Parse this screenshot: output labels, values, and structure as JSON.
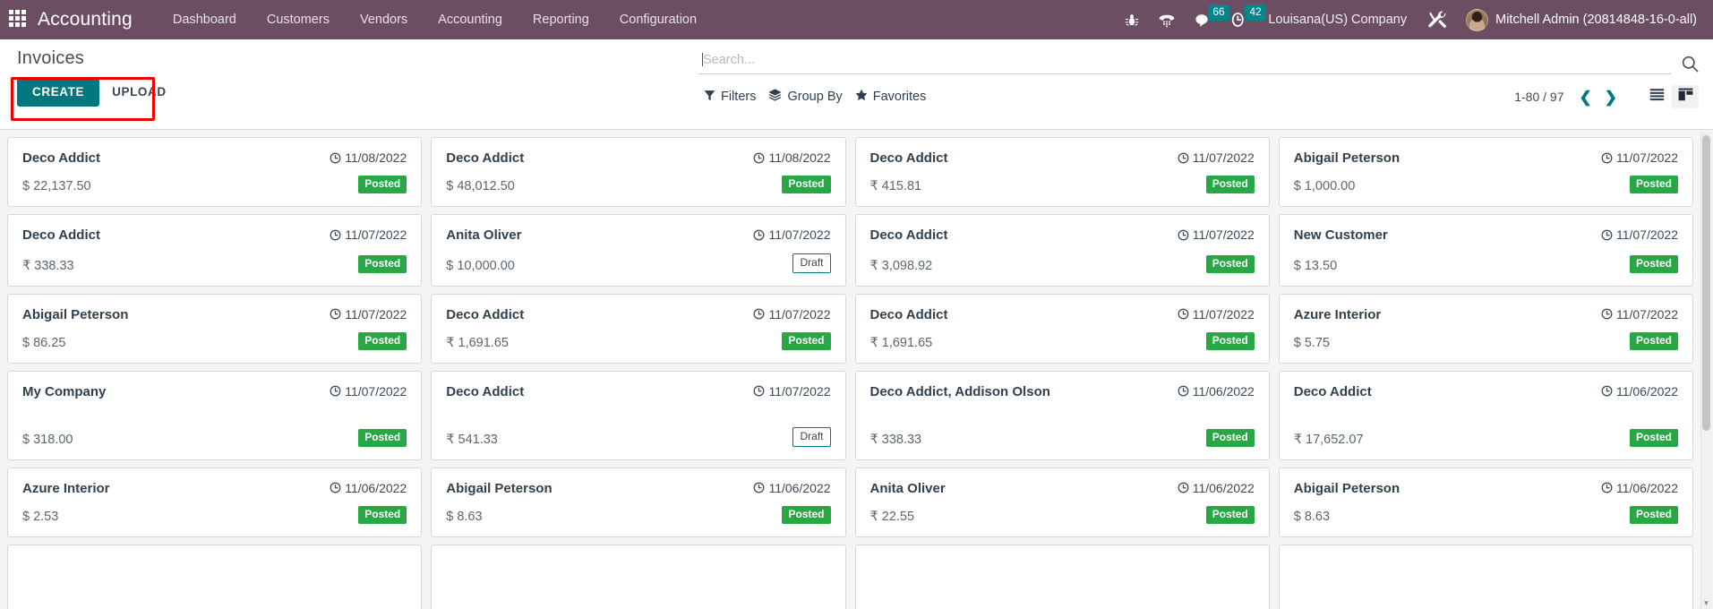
{
  "navbar": {
    "apps_icon": "apps-grid-icon",
    "brand": "Accounting",
    "menu": [
      {
        "label": "Dashboard"
      },
      {
        "label": "Customers"
      },
      {
        "label": "Vendors"
      },
      {
        "label": "Accounting"
      },
      {
        "label": "Reporting"
      },
      {
        "label": "Configuration"
      }
    ],
    "icons": {
      "bug": "bug-icon",
      "phone": "dialpad-phone-icon",
      "messages": "chat-bubble-icon",
      "activities": "clock-activity-icon",
      "tools": "wrench-screwdriver-icon"
    },
    "messages_count": "66",
    "activities_count": "42",
    "company": "Louisana(US) Company",
    "user": "Mitchell Admin (20814848-16-0-all)"
  },
  "control_panel": {
    "title": "Invoices",
    "create_label": "CREATE",
    "upload_label": "UPLOAD",
    "search": {
      "value": "",
      "placeholder": "Search...",
      "icon": "search-icon"
    },
    "tools": [
      {
        "label": "Filters",
        "icon": "filter-funnel-icon"
      },
      {
        "label": "Group By",
        "icon": "layers-icon"
      },
      {
        "label": "Favorites",
        "icon": "star-icon"
      }
    ],
    "pager": {
      "range": "1-80 / 97",
      "prev_icon": "chevron-left-icon",
      "next_icon": "chevron-right-icon"
    },
    "views": [
      {
        "name": "list-view",
        "icon": "list-icon",
        "active": false
      },
      {
        "name": "kanban-view",
        "icon": "kanban-icon",
        "active": true
      }
    ],
    "highlight_color": "#f00000"
  },
  "colors": {
    "navbar_bg": "#6b4e61",
    "primary": "#00787d",
    "posted_badge": "#28a745",
    "badge_count": "#00868b"
  },
  "kanban": {
    "date_icon": "clock-icon",
    "cards": [
      {
        "name": "Deco Addict",
        "date": "11/08/2022",
        "amount": "$ 22,137.50",
        "status": "Posted",
        "state": "posted",
        "tall": false
      },
      {
        "name": "Deco Addict",
        "date": "11/08/2022",
        "amount": "$ 48,012.50",
        "status": "Posted",
        "state": "posted",
        "tall": false
      },
      {
        "name": "Deco Addict",
        "date": "11/07/2022",
        "amount": "₹ 415.81",
        "status": "Posted",
        "state": "posted",
        "tall": false
      },
      {
        "name": "Abigail Peterson",
        "date": "11/07/2022",
        "amount": "$ 1,000.00",
        "status": "Posted",
        "state": "posted",
        "tall": false
      },
      {
        "name": "Deco Addict",
        "date": "11/07/2022",
        "amount": "₹ 338.33",
        "status": "Posted",
        "state": "posted",
        "tall": false
      },
      {
        "name": "Anita Oliver",
        "date": "11/07/2022",
        "amount": "$ 10,000.00",
        "status": "Draft",
        "state": "draft",
        "tall": false
      },
      {
        "name": "Deco Addict",
        "date": "11/07/2022",
        "amount": "₹ 3,098.92",
        "status": "Posted",
        "state": "posted",
        "tall": false
      },
      {
        "name": "New Customer",
        "date": "11/07/2022",
        "amount": "$ 13.50",
        "status": "Posted",
        "state": "posted",
        "tall": false
      },
      {
        "name": "Abigail Peterson",
        "date": "11/07/2022",
        "amount": "$ 86.25",
        "status": "Posted",
        "state": "posted",
        "tall": false
      },
      {
        "name": "Deco Addict",
        "date": "11/07/2022",
        "amount": "₹ 1,691.65",
        "status": "Posted",
        "state": "posted",
        "tall": false
      },
      {
        "name": "Deco Addict",
        "date": "11/07/2022",
        "amount": "₹ 1,691.65",
        "status": "Posted",
        "state": "posted",
        "tall": false
      },
      {
        "name": "Azure Interior",
        "date": "11/07/2022",
        "amount": "$ 5.75",
        "status": "Posted",
        "state": "posted",
        "tall": false
      },
      {
        "name": "My Company",
        "date": "11/07/2022",
        "amount": "$ 318.00",
        "status": "Posted",
        "state": "posted",
        "tall": true
      },
      {
        "name": "Deco Addict",
        "date": "11/07/2022",
        "amount": "₹ 541.33",
        "status": "Draft",
        "state": "draft",
        "tall": true
      },
      {
        "name": "Deco Addict, Addison Olson",
        "date": "11/06/2022",
        "amount": "₹ 338.33",
        "status": "Posted",
        "state": "posted",
        "tall": true
      },
      {
        "name": "Deco Addict",
        "date": "11/06/2022",
        "amount": "₹ 17,652.07",
        "status": "Posted",
        "state": "posted",
        "tall": true
      },
      {
        "name": "Azure Interior",
        "date": "11/06/2022",
        "amount": "$ 2.53",
        "status": "Posted",
        "state": "posted",
        "tall": false
      },
      {
        "name": "Abigail Peterson",
        "date": "11/06/2022",
        "amount": "$ 8.63",
        "status": "Posted",
        "state": "posted",
        "tall": false
      },
      {
        "name": "Anita Oliver",
        "date": "11/06/2022",
        "amount": "₹ 22.55",
        "status": "Posted",
        "state": "posted",
        "tall": false
      },
      {
        "name": "Abigail Peterson",
        "date": "11/06/2022",
        "amount": "$ 8.63",
        "status": "Posted",
        "state": "posted",
        "tall": false
      },
      {
        "name": "",
        "date": "",
        "amount": "",
        "status": "",
        "state": "posted",
        "tall": false
      },
      {
        "name": "",
        "date": "",
        "amount": "",
        "status": "",
        "state": "posted",
        "tall": false
      },
      {
        "name": "",
        "date": "",
        "amount": "",
        "status": "",
        "state": "posted",
        "tall": false
      },
      {
        "name": "",
        "date": "",
        "amount": "",
        "status": "",
        "state": "posted",
        "tall": false
      }
    ]
  }
}
